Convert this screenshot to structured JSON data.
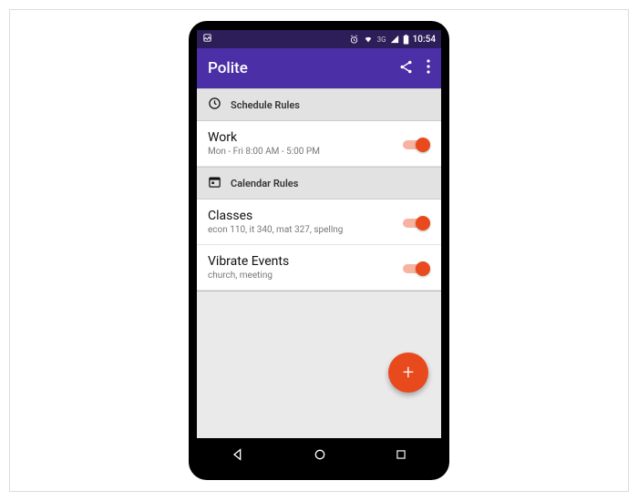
{
  "status": {
    "time": "10:54",
    "network": "3G"
  },
  "app": {
    "title": "Polite"
  },
  "sections": {
    "schedule": {
      "header": "Schedule Rules"
    },
    "calendar": {
      "header": "Calendar Rules"
    }
  },
  "rules": {
    "work": {
      "title": "Work",
      "sub": "Mon - Fri  8:00 AM - 5:00 PM"
    },
    "classes": {
      "title": "Classes",
      "sub": "econ 110, it 340, mat 327, spellng"
    },
    "vibrate": {
      "title": "Vibrate Events",
      "sub": "church, meeting"
    }
  },
  "fab": {
    "label": "+"
  }
}
